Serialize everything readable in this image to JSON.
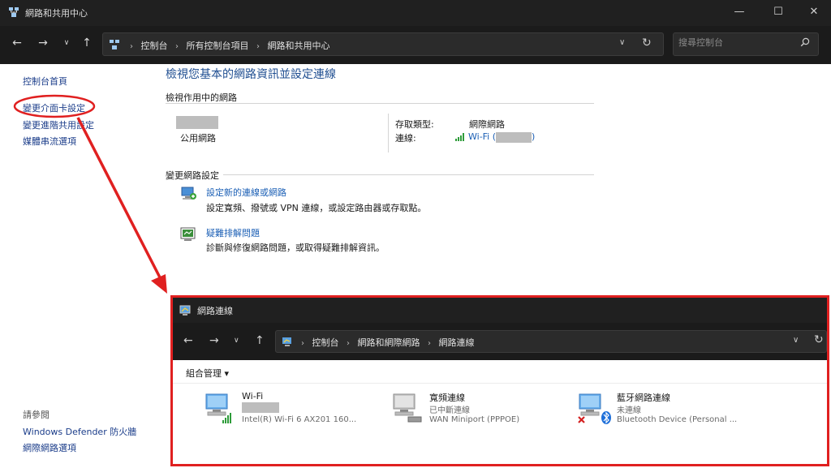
{
  "window": {
    "title": "網路和共用中心",
    "minimize_glyph": "—",
    "maximize_glyph": "☐",
    "close_glyph": "✕"
  },
  "navbar": {
    "back_glyph": "←",
    "forward_glyph": "→",
    "recent_glyph": "∨",
    "up_glyph": "↑",
    "breadcrumb": [
      "控制台",
      "所有控制台項目",
      "網路和共用中心"
    ],
    "separator": "›",
    "dropdown_glyph": "∨",
    "refresh_glyph": "↻",
    "search_placeholder": "搜尋控制台",
    "search_icon": "search-icon"
  },
  "sidebar": {
    "home": "控制台首頁",
    "items": [
      "變更介面卡設定",
      "變更進階共用設定",
      "媒體串流選項"
    ],
    "see_also_header": "請參閱",
    "see_also": [
      "Windows Defender 防火牆",
      "網際網路選項"
    ]
  },
  "main": {
    "title": "檢視您基本的網路資訊並設定連線",
    "active_networks_label": "檢視作用中的網路",
    "network_type": "公用網路",
    "access_type_label": "存取類型:",
    "access_type_value": "網際網路",
    "connection_label": "連線:",
    "connection_value_prefix": "Wi-Fi (",
    "connection_value_suffix": ")",
    "change_settings_label": "變更網路設定",
    "tasks": [
      {
        "title": "設定新的連線或網路",
        "desc": "設定寬頻、撥號或 VPN 連線，或設定路由器或存取點。",
        "icon": "new-connection-icon"
      },
      {
        "title": "疑難排解問題",
        "desc": "診斷與修復網路問題，或取得疑難排解資訊。",
        "icon": "troubleshoot-icon"
      }
    ]
  },
  "overlay": {
    "title": "網路連線",
    "back_glyph": "←",
    "forward_glyph": "→",
    "recent_glyph": "∨",
    "up_glyph": "↑",
    "breadcrumb": [
      "控制台",
      "網路和網際網路",
      "網路連線"
    ],
    "separator": "›",
    "dropdown_glyph": "∨",
    "refresh_glyph": "↻",
    "organize": "組合管理 ▾",
    "connections": [
      {
        "name": "Wi-Fi",
        "status": "",
        "device": "Intel(R) Wi-Fi 6 AX201 160...",
        "icon": "wifi-adapter-icon"
      },
      {
        "name": "寬頻連線",
        "status": "已中斷連線",
        "device": "WAN Miniport (PPPOE)",
        "icon": "broadband-adapter-icon"
      },
      {
        "name": "藍牙網路連線",
        "status": "未連線",
        "device": "Bluetooth Device (Personal ...",
        "icon": "bluetooth-adapter-icon"
      }
    ]
  },
  "colors": {
    "annotation": "#e02020",
    "link": "#1b5fb5",
    "title_blue": "#1f4e91",
    "dark_chrome": "#202020"
  }
}
